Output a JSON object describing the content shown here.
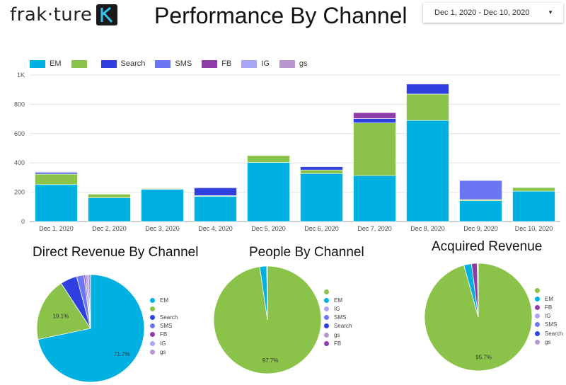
{
  "header": {
    "logo_text": "frak·ture",
    "title": "Performance By Channel",
    "date_range": "Dec 1, 2020 - Dec 10, 2020"
  },
  "colors": {
    "EM": "#00b0e0",
    "green": "#8bc34a",
    "Search": "#2f3fe0",
    "SMS": "#6b76f5",
    "FB": "#8e3ca8",
    "IG": "#a8a6f5",
    "gs": "#b896cf"
  },
  "chart_data": [
    {
      "type": "bar",
      "stacked": true,
      "categories": [
        "Dec 1, 2020",
        "Dec 2, 2020",
        "Dec 3, 2020",
        "Dec 4, 2020",
        "Dec 5, 2020",
        "Dec 6, 2020",
        "Dec 7, 2020",
        "Dec 8, 2020",
        "Dec 9, 2020",
        "Dec 10, 2020"
      ],
      "ylim": [
        0,
        1000
      ],
      "yticks": [
        0,
        200,
        400,
        600,
        800,
        1000
      ],
      "ytick_labels": [
        "0",
        "200",
        "400",
        "600",
        "800",
        "1K"
      ],
      "grid": true,
      "legend_position": "top-left",
      "series": [
        {
          "name": "EM",
          "color": "#00b0e0",
          "values": [
            252,
            162,
            220,
            172,
            403,
            327,
            313,
            690,
            142,
            207
          ]
        },
        {
          "name": "",
          "color": "#8bc34a",
          "values": [
            72,
            25,
            5,
            5,
            47,
            25,
            360,
            180,
            8,
            25
          ]
        },
        {
          "name": "Search",
          "color": "#2f3fe0",
          "values": [
            10,
            0,
            0,
            53,
            0,
            22,
            30,
            68,
            0,
            0
          ]
        },
        {
          "name": "SMS",
          "color": "#6b76f5",
          "values": [
            5,
            0,
            0,
            0,
            0,
            0,
            0,
            0,
            130,
            0
          ]
        },
        {
          "name": "FB",
          "color": "#8e3ca8",
          "values": [
            0,
            0,
            0,
            0,
            0,
            0,
            40,
            0,
            0,
            0
          ]
        },
        {
          "name": "IG",
          "color": "#a8a6f5",
          "values": [
            0,
            0,
            0,
            5,
            0,
            0,
            0,
            0,
            0,
            0
          ]
        },
        {
          "name": "gs",
          "color": "#b896cf",
          "values": [
            4,
            0,
            0,
            0,
            0,
            0,
            0,
            0,
            0,
            0
          ]
        }
      ]
    },
    {
      "type": "pie",
      "title": "Direct Revenue By Channel",
      "slices": [
        {
          "label": "EM",
          "value": 71.7,
          "color": "#00b0e0",
          "show_label": "71.7%"
        },
        {
          "label": "",
          "value": 19.1,
          "color": "#8bc34a",
          "show_label": "19.1%"
        },
        {
          "label": "Search",
          "value": 5.0,
          "color": "#2f3fe0",
          "show_label": ""
        },
        {
          "label": "SMS",
          "value": 2.2,
          "color": "#6b76f5",
          "show_label": ""
        },
        {
          "label": "FB",
          "value": 0.5,
          "color": "#8e3ca8",
          "show_label": ""
        },
        {
          "label": "IG",
          "value": 0.8,
          "color": "#a8a6f5",
          "show_label": ""
        },
        {
          "label": "gs",
          "value": 0.7,
          "color": "#b896cf",
          "show_label": ""
        }
      ]
    },
    {
      "type": "pie",
      "title": "People By Channel",
      "slices": [
        {
          "label": "",
          "value": 97.7,
          "color": "#8bc34a",
          "show_label": "97.7%"
        },
        {
          "label": "EM",
          "value": 2.1,
          "color": "#00b0e0",
          "show_label": ""
        },
        {
          "label": "IG",
          "value": 0.05,
          "color": "#a8a6f5",
          "show_label": ""
        },
        {
          "label": "SMS",
          "value": 0.05,
          "color": "#6b76f5",
          "show_label": ""
        },
        {
          "label": "Search",
          "value": 0.05,
          "color": "#2f3fe0",
          "show_label": ""
        },
        {
          "label": "gs",
          "value": 0.03,
          "color": "#b896cf",
          "show_label": ""
        },
        {
          "label": "FB",
          "value": 0.02,
          "color": "#8e3ca8",
          "show_label": ""
        }
      ]
    },
    {
      "type": "pie",
      "title": "Acquired Revenue",
      "slices": [
        {
          "label": "",
          "value": 95.7,
          "color": "#8bc34a",
          "show_label": "95.7%"
        },
        {
          "label": "EM",
          "value": 2.3,
          "color": "#00b0e0",
          "show_label": ""
        },
        {
          "label": "FB",
          "value": 1.7,
          "color": "#8e3ca8",
          "show_label": ""
        },
        {
          "label": "IG",
          "value": 0.1,
          "color": "#a8a6f5",
          "show_label": ""
        },
        {
          "label": "SMS",
          "value": 0.1,
          "color": "#6b76f5",
          "show_label": ""
        },
        {
          "label": "Search",
          "value": 0.05,
          "color": "#2f3fe0",
          "show_label": ""
        },
        {
          "label": "gs",
          "value": 0.05,
          "color": "#b896cf",
          "show_label": ""
        }
      ]
    }
  ]
}
